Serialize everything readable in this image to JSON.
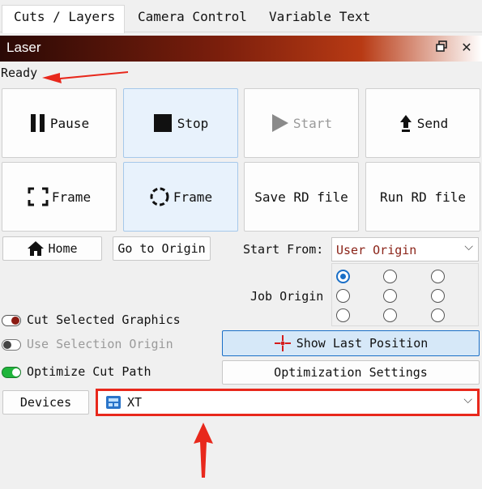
{
  "tabs": [
    {
      "label": "Cuts / Layers"
    },
    {
      "label": "Camera Control"
    },
    {
      "label": "Variable Text"
    }
  ],
  "panel": {
    "title": "Laser"
  },
  "status": "Ready",
  "buttons": {
    "pause": "Pause",
    "stop": "Stop",
    "start": "Start",
    "send": "Send",
    "frame1": "Frame",
    "frame2": "Frame",
    "save_rd": "Save RD file",
    "run_rd": "Run RD file",
    "home": "Home",
    "go_to_origin": "Go to Origin",
    "show_last_position": "Show Last Position",
    "optimization_settings": "Optimization Settings",
    "devices": "Devices"
  },
  "start_from": {
    "label": "Start From:",
    "value": "User Origin"
  },
  "job_origin": {
    "label": "Job Origin",
    "selected": "top-left"
  },
  "options": [
    {
      "label": "Cut Selected Graphics",
      "state": "off-red"
    },
    {
      "label": "Use Selection Origin",
      "state": "disabled"
    },
    {
      "label": "Optimize Cut Path",
      "state": "on"
    }
  ],
  "device": {
    "value": "XT"
  },
  "colors": {
    "highlight": "#e8281c",
    "accent": "#1a6fc7",
    "header_dark": "#2a0905"
  }
}
